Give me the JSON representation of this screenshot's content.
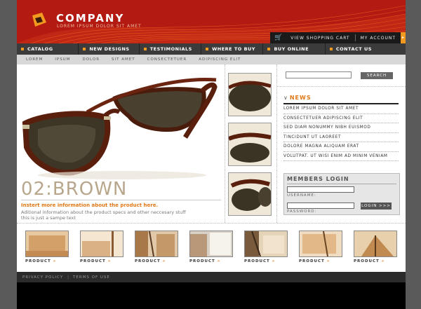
{
  "brand": {
    "name": "COMPANY",
    "tagline": "LOREM IPSUM DOLOR SIT AMET"
  },
  "util_nav": {
    "cart": "VIEW SHOPPING CART",
    "account": "MY ACCOUNT"
  },
  "main_nav": [
    "CATALOG",
    "NEW DESIGNS",
    "TESTIMONIALS",
    "WHERE TO BUY",
    "BUY ONLINE",
    "CONTACT US"
  ],
  "sub_nav": [
    "LOREM",
    "IPSUM",
    "DOLOR",
    "SIT AMET",
    "CONSECTETUER",
    "ADIPISCING ELIT"
  ],
  "hero": {
    "title": "02:BROWN",
    "subtitle": "Instert more information about the product here.",
    "desc_line1": "Aditional information about the product specs and other neccesary stuff",
    "desc_line2": "this is just a sampe text"
  },
  "search": {
    "placeholder": "",
    "button": "SEARCH >>>"
  },
  "news": {
    "title": "NEWS",
    "items": [
      "LOREM IPSUM DOLOR SIT AMET",
      "CONSECTETUER ADIPISCING ELIT",
      "SED DIAM NONUMMY NIBH EUISMOD",
      "TINCIDUNT UT LAOREET",
      "DOLORE MAGNA ALIQUAM ERAT",
      "VOLUTPAT. UT WISI ENIM AD MINIM VENIAM"
    ]
  },
  "members": {
    "title": "MEMBERS LOGIN",
    "username": "USERNAME:",
    "password": "PASSWORD:",
    "login": "LOGIN >>>"
  },
  "products": [
    "PRODUCT",
    "PRODUCT",
    "PRODUCT",
    "PRODUCT",
    "PRODUCT",
    "PRODUCT",
    "PRODUCT"
  ],
  "footer": {
    "privacy": "PRIVACY POLICY",
    "sep": "|",
    "terms": "TERMS OF USE"
  },
  "colors": {
    "header_red": "#b31a12",
    "accent_orange": "#f29a1f",
    "nav_dark": "#3b3b3b",
    "title_tan": "#b8a78c"
  }
}
